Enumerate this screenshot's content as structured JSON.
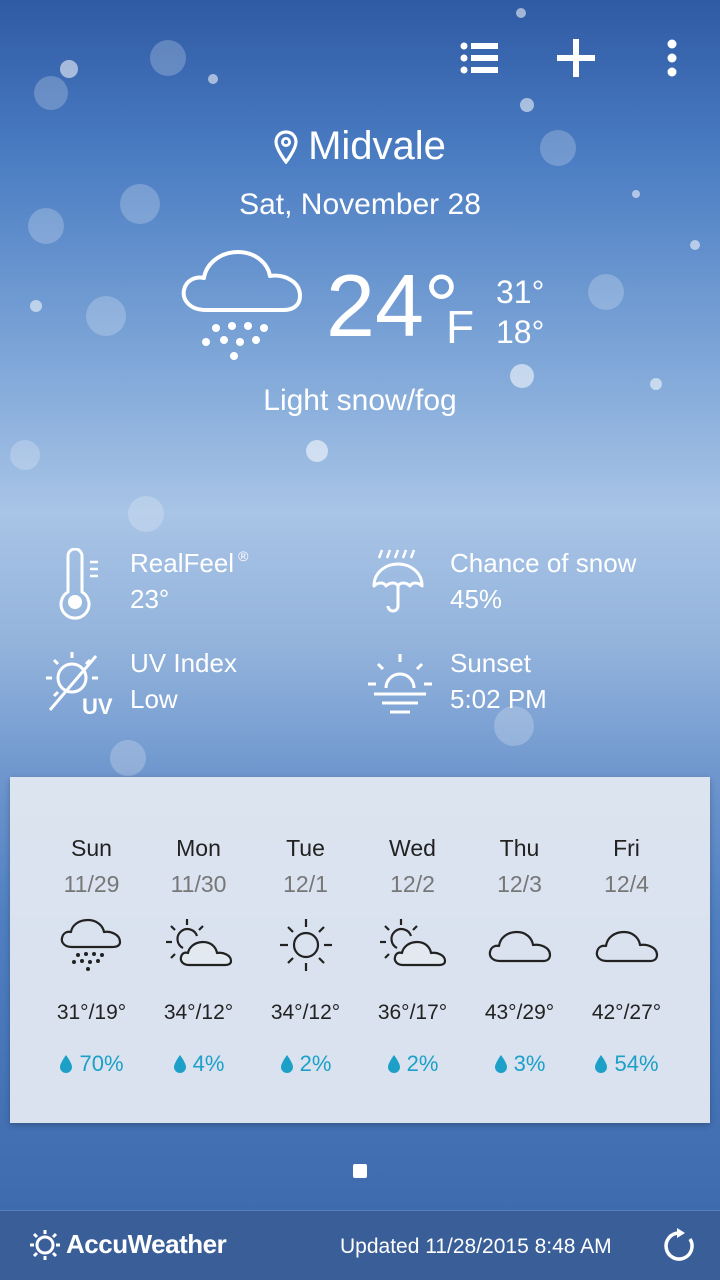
{
  "header": {
    "location": "Midvale",
    "date": "Sat, November 28"
  },
  "current": {
    "temp": "24°",
    "unit": "F",
    "high": "31°",
    "low": "18°",
    "condition": "Light snow/fog",
    "icon": "snow-cloud-icon"
  },
  "details": {
    "realfeel": {
      "label": "RealFeel",
      "mark": "®",
      "value": "23°",
      "icon": "thermometer-icon"
    },
    "snow_chance": {
      "label": "Chance of snow",
      "value": "45%",
      "icon": "umbrella-icon"
    },
    "uv": {
      "label": "UV Index",
      "value": "Low",
      "badge": "UV",
      "icon": "uv-icon"
    },
    "sunset": {
      "label": "Sunset",
      "value": "5:02 PM",
      "icon": "sunset-icon"
    }
  },
  "forecast": [
    {
      "day": "Sun",
      "date": "11/29",
      "temps": "31°/19°",
      "precip": "70%",
      "icon": "snow-cloud-icon"
    },
    {
      "day": "Mon",
      "date": "11/30",
      "temps": "34°/12°",
      "precip": "4%",
      "icon": "partly-cloudy-icon"
    },
    {
      "day": "Tue",
      "date": "12/1",
      "temps": "34°/12°",
      "precip": "2%",
      "icon": "sun-icon"
    },
    {
      "day": "Wed",
      "date": "12/2",
      "temps": "36°/17°",
      "precip": "2%",
      "icon": "partly-cloudy-icon"
    },
    {
      "day": "Thu",
      "date": "12/3",
      "temps": "43°/29°",
      "precip": "3%",
      "icon": "cloud-icon"
    },
    {
      "day": "Fri",
      "date": "12/4",
      "temps": "42°/27°",
      "precip": "54%",
      "icon": "cloud-icon"
    }
  ],
  "footer": {
    "brand": "AccuWeather",
    "updated": "Updated 11/28/2015 8:48 AM"
  },
  "colors": {
    "precip": "#1ca0c8",
    "footer_bg": "#3a5f98"
  }
}
